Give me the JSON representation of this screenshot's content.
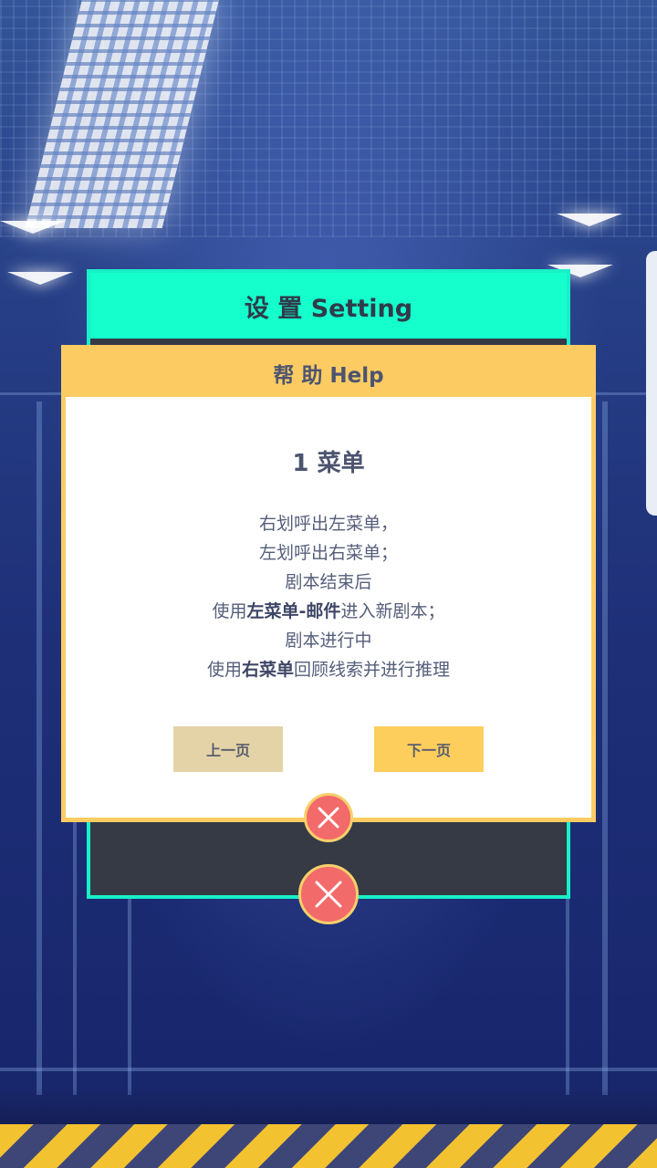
{
  "settings": {
    "title": "设 置 Setting"
  },
  "help": {
    "title": "帮 助 Help",
    "heading": "1 菜单",
    "lines": {
      "l1": "右划呼出左菜单，",
      "l2": "左划呼出右菜单；",
      "l3": "剧本结束后",
      "l4_pre": "使用",
      "l4_bold": "左菜单-邮件",
      "l4_post": "进入新剧本；",
      "l5": "剧本进行中",
      "l6_pre": "使用",
      "l6_bold": "右菜单",
      "l6_post": "回顾线索并进行推理"
    },
    "prev_label": "上一页",
    "next_label": "下一页"
  },
  "colors": {
    "settings_accent": "#14ffcc",
    "help_accent": "#fccc63",
    "close_red": "#f36a6a"
  },
  "icons": {
    "close": "close-icon"
  }
}
